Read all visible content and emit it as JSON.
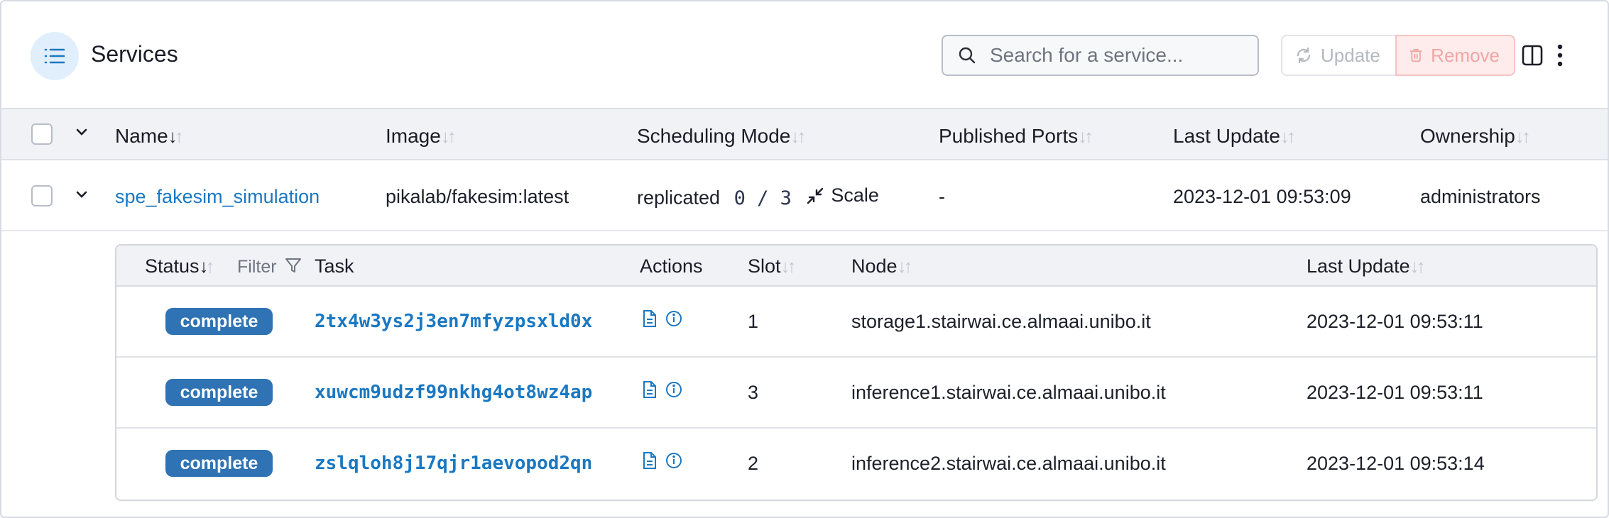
{
  "header": {
    "title": "Services",
    "search_placeholder": "Search for a service...",
    "update_label": "Update",
    "remove_label": "Remove"
  },
  "table": {
    "columns": [
      "Name",
      "Image",
      "Scheduling Mode",
      "Published Ports",
      "Last Update",
      "Ownership"
    ],
    "rows": [
      {
        "name": "spe_fakesim_simulation",
        "image": "pikalab/fakesim:latest",
        "mode": "replicated",
        "replicas": "0 / 3",
        "scale_label": "Scale",
        "ports": "-",
        "last_update": "2023-12-01 09:53:09",
        "ownership": "administrators"
      }
    ]
  },
  "tasks": {
    "columns": [
      "Status",
      "Task",
      "Actions",
      "Slot",
      "Node",
      "Last Update"
    ],
    "filter_label": "Filter",
    "rows": [
      {
        "status": "complete",
        "task": "2tx4w3ys2j3en7mfyzpsxld0x",
        "slot": "1",
        "node": "storage1.stairwai.ce.almaai.unibo.it",
        "last_update": "2023-12-01 09:53:11"
      },
      {
        "status": "complete",
        "task": "xuwcm9udzf99nkhg4ot8wz4ap",
        "slot": "3",
        "node": "inference1.stairwai.ce.almaai.unibo.it",
        "last_update": "2023-12-01 09:53:11"
      },
      {
        "status": "complete",
        "task": "zslqloh8j17qjr1aevopod2qn",
        "slot": "2",
        "node": "inference2.stairwai.ce.almaai.unibo.it",
        "last_update": "2023-12-01 09:53:14"
      }
    ]
  },
  "icons": {
    "list": "list-icon",
    "search": "search-icon",
    "update": "refresh-icon",
    "remove": "trash-icon",
    "columns": "columns-icon",
    "more": "more-vertical-icon",
    "scale": "shrink-icon",
    "logs": "file-text-icon",
    "info": "info-icon",
    "filter": "filter-icon",
    "expand": "chevron-down-icon"
  },
  "colors": {
    "accent": "#1a78c2",
    "badge": "#2f73b4",
    "remove_bg": "#fdeceb",
    "header_bg": "#f1f2f6"
  }
}
